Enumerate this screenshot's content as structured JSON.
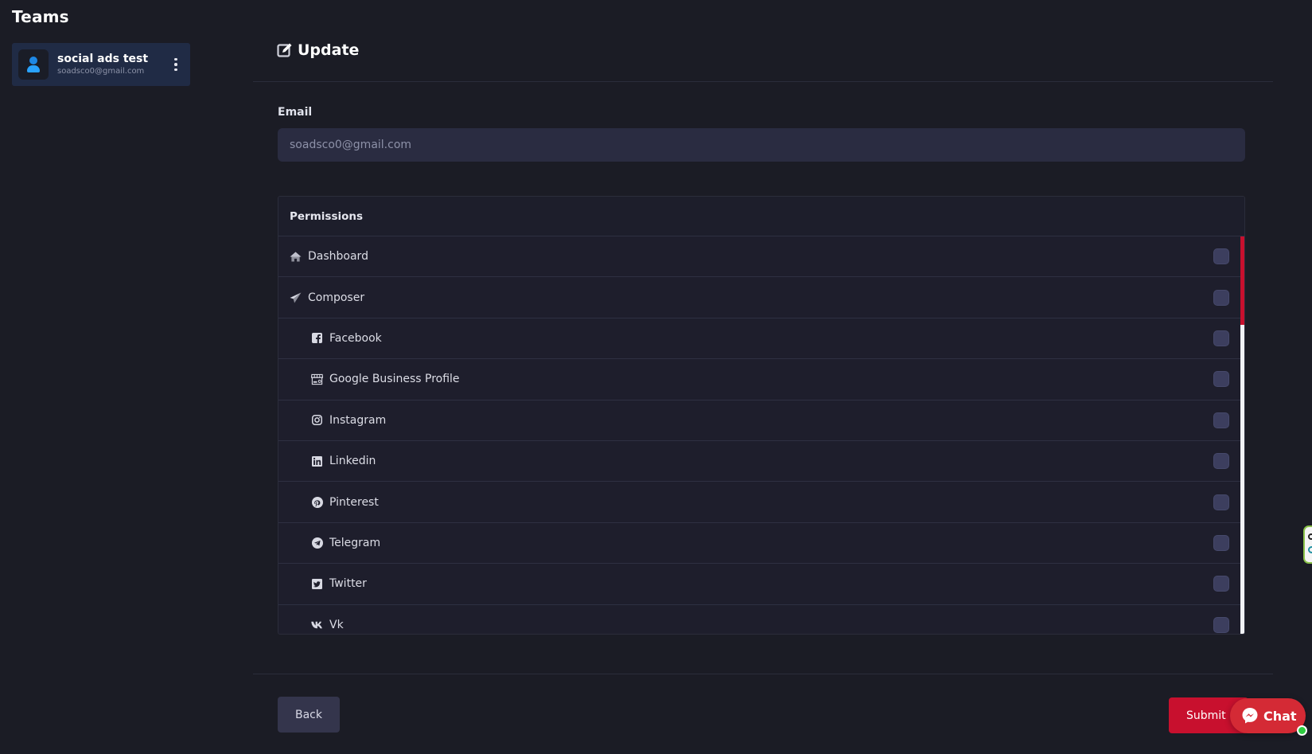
{
  "sidebar": {
    "title": "Teams",
    "team": {
      "name": "social ads test",
      "email": "soadsco0@gmail.com",
      "avatar_icon": "user-icon",
      "menu_icon": "more-vertical-icon"
    }
  },
  "form": {
    "header": {
      "icon": "edit-icon",
      "title": "Update"
    },
    "email": {
      "label": "Email",
      "value": "",
      "placeholder": "soadsco0@gmail.com"
    },
    "permissions": {
      "title": "Permissions",
      "items": [
        {
          "label": "Dashboard",
          "icon": "home-icon",
          "level": 0,
          "checked": false
        },
        {
          "label": "Composer",
          "icon": "paper-plane-icon",
          "level": 0,
          "checked": false
        },
        {
          "label": "Facebook",
          "icon": "facebook-icon",
          "level": 1,
          "checked": false
        },
        {
          "label": "Google Business Profile",
          "icon": "store-icon",
          "level": 1,
          "checked": false
        },
        {
          "label": "Instagram",
          "icon": "instagram-icon",
          "level": 1,
          "checked": false
        },
        {
          "label": "Linkedin",
          "icon": "linkedin-icon",
          "level": 1,
          "checked": false
        },
        {
          "label": "Pinterest",
          "icon": "pinterest-icon",
          "level": 1,
          "checked": false
        },
        {
          "label": "Telegram",
          "icon": "telegram-icon",
          "level": 1,
          "checked": false
        },
        {
          "label": "Twitter",
          "icon": "twitter-icon",
          "level": 1,
          "checked": false
        },
        {
          "label": "Vk",
          "icon": "vk-icon",
          "level": 1,
          "checked": false
        }
      ]
    },
    "buttons": {
      "back": "Back",
      "submit": "Submit"
    }
  },
  "chat_widget": {
    "label": "Chat",
    "icon": "messenger-icon",
    "status": "online"
  },
  "colors": {
    "accent": "#c8102e",
    "background": "#1b1c25",
    "input_bg": "#2a2c41",
    "team_card_bg": "#202b45"
  }
}
